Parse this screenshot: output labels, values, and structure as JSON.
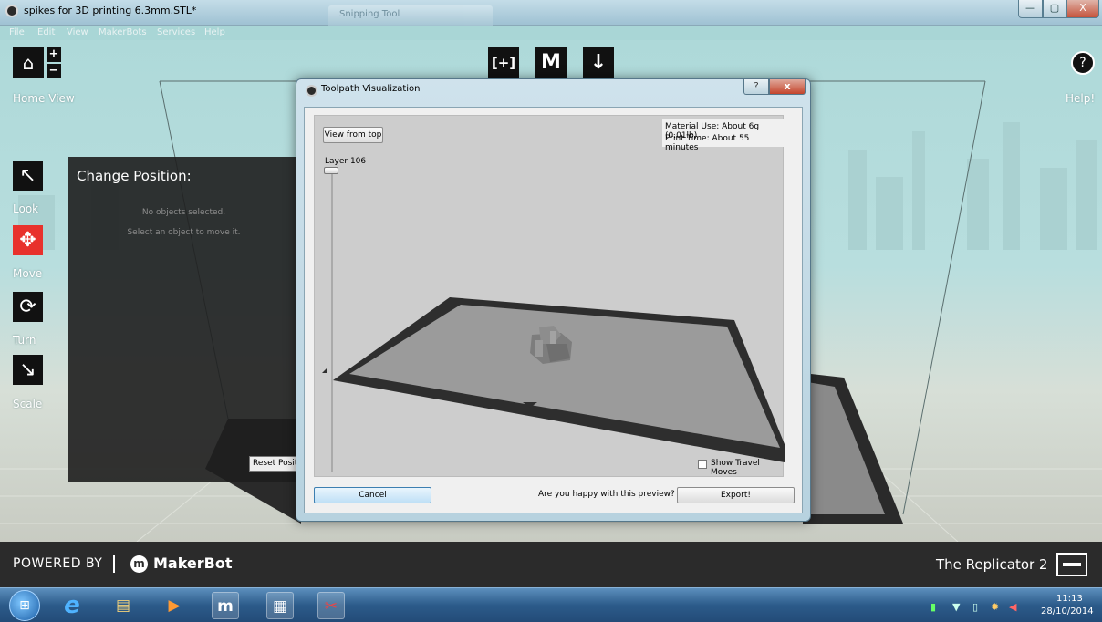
{
  "window": {
    "title": "spikes for 3D printing 6.3mm.STL*",
    "ghost_tab": "Snipping Tool",
    "minimize": "—",
    "maximize": "▢",
    "close": "X"
  },
  "menu": [
    "File",
    "Edit",
    "View",
    "MakerBots",
    "Services",
    "Help"
  ],
  "toolbar": {
    "add_label": "[+]",
    "makerbot_label": "M",
    "export_label": "↓"
  },
  "left": {
    "home_icon": "⌂",
    "home_label": "Home View",
    "zoom_in": "+",
    "zoom_out": "−",
    "tools": [
      {
        "label": "Look",
        "icon": "↖"
      },
      {
        "label": "Move",
        "icon": "✥"
      },
      {
        "label": "Turn",
        "icon": "⟳"
      },
      {
        "label": "Scale",
        "icon": "↘"
      }
    ]
  },
  "help": {
    "icon": "?",
    "label": "Help!"
  },
  "change_position": {
    "title": "Change Position:",
    "msg1": "No objects selected.",
    "msg2": "Select an object to move it.",
    "reset_label": "Reset Positi"
  },
  "dialog": {
    "title": "Toolpath Visualization",
    "help_btn": "?",
    "close_btn": "x",
    "view_from_top": "View from top",
    "layer_label": "Layer 106",
    "material_use": "Material Use: About 6g (0.01lb)",
    "print_time": "Print Time: About 55 minutes",
    "show_travel": "Show Travel Moves",
    "cancel": "Cancel",
    "question": "Are you happy with this preview?",
    "export": "Export!"
  },
  "footer": {
    "powered_by": "POWERED BY",
    "logo_mark": "m",
    "brand": "MakerBot",
    "printer": "The Replicator 2"
  },
  "taskbar": {
    "start": "⊞",
    "apps": [
      {
        "name": "internet-explorer",
        "glyph": "e"
      },
      {
        "name": "file-explorer",
        "glyph": "▤"
      },
      {
        "name": "media-player",
        "glyph": "▶"
      },
      {
        "name": "makerware",
        "glyph": "m"
      },
      {
        "name": "notepad",
        "glyph": "▦"
      },
      {
        "name": "snipping-tool",
        "glyph": "✂"
      }
    ],
    "time": "11:13",
    "date": "28/10/2014"
  }
}
